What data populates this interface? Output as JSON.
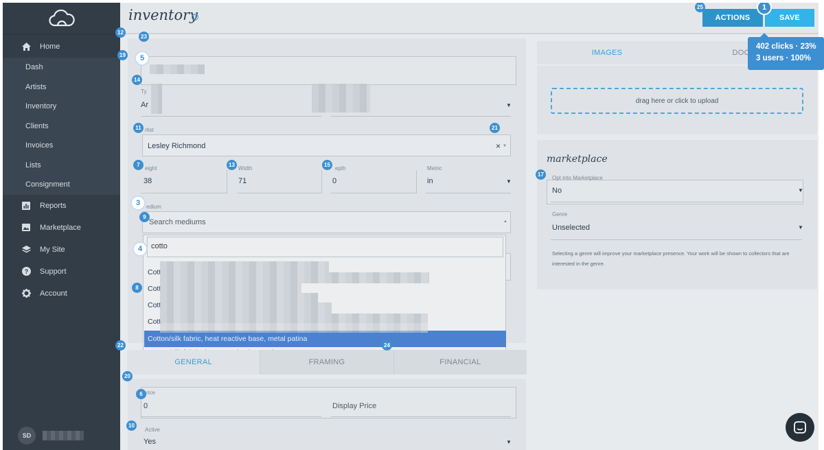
{
  "sidebar": {
    "nav": [
      {
        "label": "Home",
        "icon": "home-icon",
        "type": "main"
      },
      {
        "label": "Dash",
        "type": "sub"
      },
      {
        "label": "Artists",
        "type": "sub"
      },
      {
        "label": "Inventory",
        "type": "sub"
      },
      {
        "label": "Clients",
        "type": "sub"
      },
      {
        "label": "Invoices",
        "type": "sub"
      },
      {
        "label": "Lists",
        "type": "sub"
      },
      {
        "label": "Consignment",
        "type": "sub"
      },
      {
        "label": "Reports",
        "icon": "chart-icon",
        "type": "main"
      },
      {
        "label": "Marketplace",
        "icon": "image-icon",
        "type": "main"
      },
      {
        "label": "My Site",
        "icon": "layers-icon",
        "type": "main"
      },
      {
        "label": "Support",
        "icon": "help-circle-icon",
        "type": "main"
      },
      {
        "label": "Account",
        "icon": "gear-icon",
        "type": "main"
      }
    ],
    "user_initials": "SD"
  },
  "header": {
    "title": "inventory",
    "help": "?",
    "actions_label": "ACTIONS",
    "save_label": "SAVE"
  },
  "form": {
    "type_label": "Ty",
    "type_value": "Ar",
    "artist_label": "rtist",
    "artist_value": "Lesley Richmond",
    "artist_clear": "×",
    "height_label": "eight",
    "height_value": "38",
    "width_label": "Width",
    "width_value": "71",
    "depth_label": "epth",
    "depth_value": "0",
    "metric_label": "Metric",
    "metric_value": "in",
    "medium_label": "edium",
    "medium_placeholder": "Search mediums",
    "medium_search_value": "cotto",
    "medium_options": [
      "Cott",
      "Cott",
      "Cott",
      "Cott",
      "Cotton/silk fabric, heat reactive base, metal patina",
      "Cotton/silk fabric, heat reactive base, pigments"
    ],
    "price_label": "rice",
    "price_value": "0",
    "display_price_placeholder": "Display Price",
    "active_label": "Active",
    "active_value": "Yes"
  },
  "tabs": [
    "GENERAL",
    "FRAMING",
    "FINANCIAL"
  ],
  "right": {
    "tabs": [
      "IMAGES",
      "DOCUM"
    ],
    "upload_text": "drag here or click to upload",
    "marketplace_title": "marketplace",
    "opt_label": "Opt into Marketplace",
    "opt_value": "No",
    "genre_label": "Genre",
    "genre_value": "Unselected",
    "genre_note": "Selecting a genre will improve your marketplace presence. Your work will be shown to collectors that are interested in the genre."
  },
  "heatmap": {
    "tooltip_line1": "402 clicks · 23%",
    "tooltip_line2": "3 users · 100%",
    "badges": [
      "1",
      "3",
      "4",
      "5",
      "6",
      "7",
      "8",
      "9",
      "10",
      "11",
      "12",
      "13",
      "14",
      "15",
      "17",
      "19",
      "20",
      "21",
      "22",
      "23",
      "24",
      "25"
    ]
  },
  "colors": {
    "sidebar": "#323d47",
    "accent": "#3a9bd9",
    "save_button": "#33b3e9",
    "heatmap_badge": "#3d8fd1",
    "selected_option": "#4b82cf"
  }
}
